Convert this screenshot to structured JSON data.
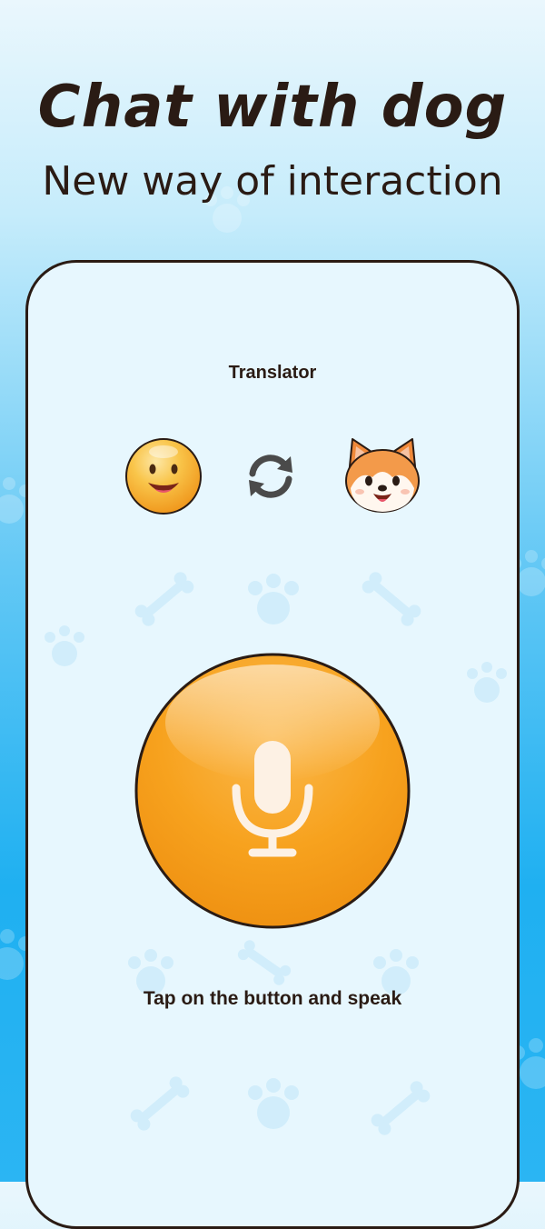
{
  "headline": "Chat with dog",
  "subheadline": "New way of interaction",
  "screen": {
    "title": "Translator",
    "hint": "Tap on the button and speak"
  },
  "icons": {
    "human": "smiling-face-icon",
    "swap": "swap-arrows-icon",
    "dog": "shiba-dog-face-icon",
    "mic": "microphone-icon",
    "background": "paw-and-bone-pattern"
  },
  "colors": {
    "accent": "#f7a21e",
    "text": "#2a1b14",
    "screen_bg": "#e7f7fe",
    "sky": "#1fb0f1"
  }
}
